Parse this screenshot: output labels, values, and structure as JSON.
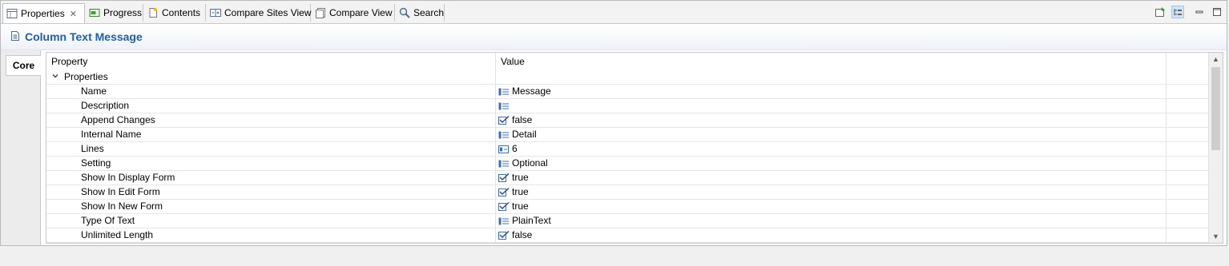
{
  "tabs": [
    {
      "label": "Properties",
      "icon": "properties-icon",
      "active": true
    },
    {
      "label": "Progress",
      "icon": "progress-icon"
    },
    {
      "label": "Contents",
      "icon": "contents-icon"
    },
    {
      "label": "Compare Sites View",
      "icon": "compare-sites-icon"
    },
    {
      "label": "Compare View",
      "icon": "compare-view-icon"
    },
    {
      "label": "Search",
      "icon": "search-icon"
    }
  ],
  "toolbar": {
    "new_view_icon": "pin-icon",
    "categories_icon": "categories-icon",
    "minimize_icon": "minimize-icon",
    "maximize_icon": "maximize-icon"
  },
  "panel": {
    "title": "Column Text Message",
    "side_tab": "Core"
  },
  "table": {
    "columns": [
      "Property",
      "Value"
    ],
    "group": "Properties",
    "rows": [
      {
        "name": "Name",
        "value": "Message",
        "icon": "text-icon"
      },
      {
        "name": "Description",
        "value": "",
        "icon": "text-icon"
      },
      {
        "name": "Append Changes",
        "value": "false",
        "icon": "checkbox-icon"
      },
      {
        "name": "Internal Name",
        "value": "Detail",
        "icon": "text-icon"
      },
      {
        "name": "Lines",
        "value": "6",
        "icon": "number-icon"
      },
      {
        "name": "Setting",
        "value": "Optional",
        "icon": "text-icon"
      },
      {
        "name": "Show In Display Form",
        "value": "true",
        "icon": "checkbox-icon"
      },
      {
        "name": "Show In Edit Form",
        "value": "true",
        "icon": "checkbox-icon"
      },
      {
        "name": "Show In New Form",
        "value": "true",
        "icon": "checkbox-icon"
      },
      {
        "name": "Type Of Text",
        "value": "PlainText",
        "icon": "text-icon"
      },
      {
        "name": "Unlimited Length",
        "value": "false",
        "icon": "checkbox-icon"
      }
    ]
  },
  "colors": {
    "title": "#1e5fa8",
    "selection": "#cfe3f7"
  }
}
